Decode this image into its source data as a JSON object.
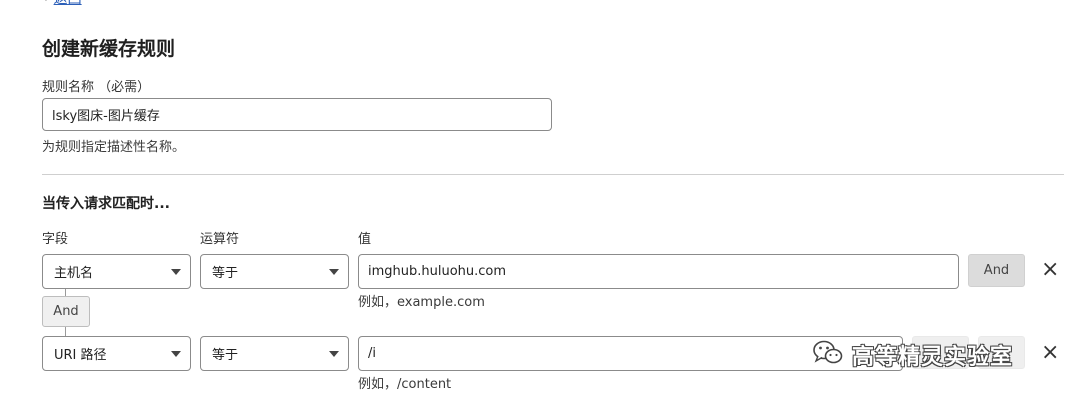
{
  "nav": {
    "back_label": "返回"
  },
  "page": {
    "title": "创建新缓存规则"
  },
  "rule_name": {
    "label": "规则名称 （必需）",
    "value": "lsky图床-图片缓存",
    "help": "为规则指定描述性名称。"
  },
  "match": {
    "title": "当传入请求匹配时...",
    "headers": {
      "field": "字段",
      "operator": "运算符",
      "value": "值"
    },
    "rows": [
      {
        "field": "主机名",
        "operator": "等于",
        "value": "imghub.huluohu.com",
        "hint": "例如，example.com",
        "and_button": "And"
      },
      {
        "field": "URI 路径",
        "operator": "等于",
        "value": "/i",
        "hint": "例如，/content"
      }
    ],
    "connector_label": "And"
  },
  "watermark": {
    "text": "高等精灵实验室"
  },
  "icons": {
    "back": "chevron-left-icon",
    "close": "close-icon",
    "dropdown": "chevron-down-icon",
    "wechat": "wechat-icon"
  }
}
